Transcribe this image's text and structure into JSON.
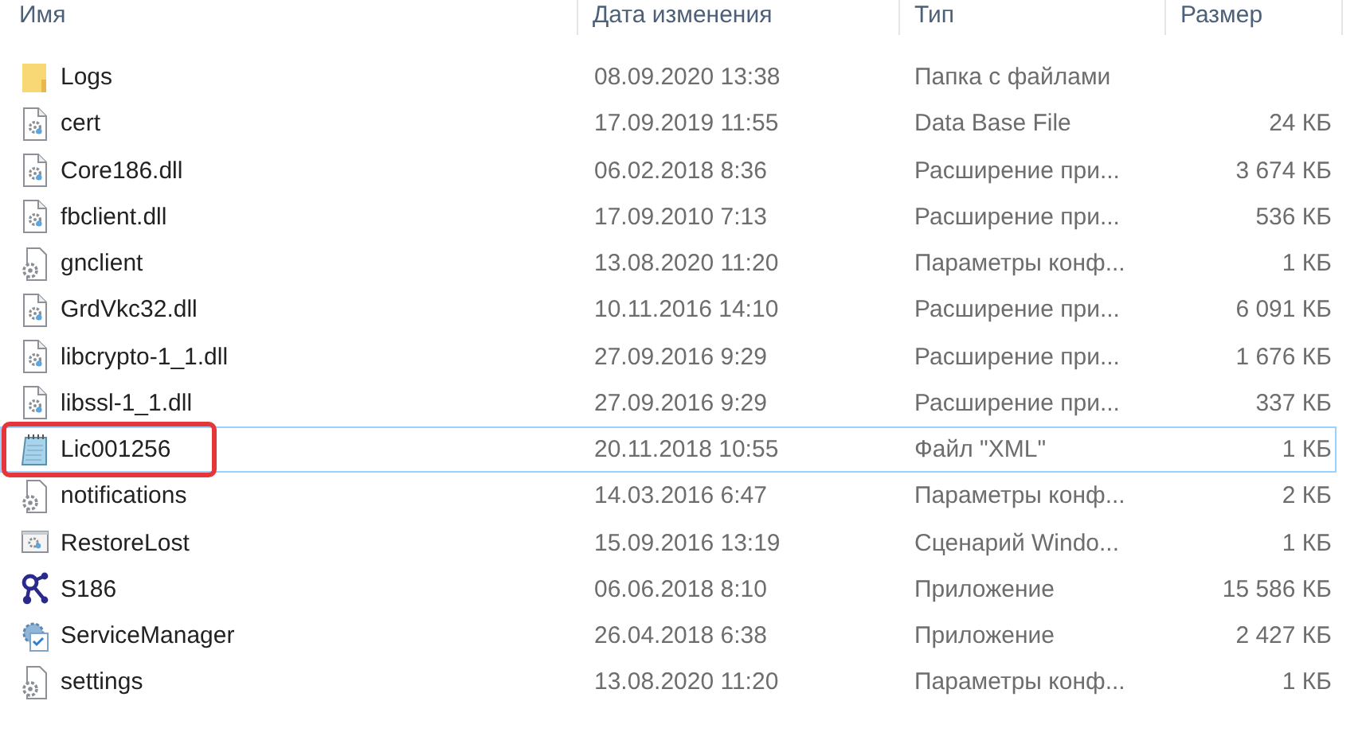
{
  "columns": [
    "Имя",
    "Дата изменения",
    "Тип",
    "Размер"
  ],
  "rows": [
    {
      "kind": "folder",
      "name": "Logs",
      "date": "08.09.2020 13:38",
      "type": "Папка с файлами",
      "size": "",
      "focused": false,
      "annotated": false
    },
    {
      "kind": "system",
      "name": "cert",
      "date": "17.09.2019 11:55",
      "type": "Data Base File",
      "size": "24 КБ",
      "focused": false,
      "annotated": false
    },
    {
      "kind": "system",
      "name": "Core186.dll",
      "date": "06.02.2018 8:36",
      "type": "Расширение при...",
      "size": "3 674 КБ",
      "focused": false,
      "annotated": false
    },
    {
      "kind": "system",
      "name": "fbclient.dll",
      "date": "17.09.2010 7:13",
      "type": "Расширение при...",
      "size": "536 КБ",
      "focused": false,
      "annotated": false
    },
    {
      "kind": "config",
      "name": "gnclient",
      "date": "13.08.2020 11:20",
      "type": "Параметры конф...",
      "size": "1 КБ",
      "focused": false,
      "annotated": false
    },
    {
      "kind": "system",
      "name": "GrdVkc32.dll",
      "date": "10.11.2016 14:10",
      "type": "Расширение при...",
      "size": "6 091 КБ",
      "focused": false,
      "annotated": false
    },
    {
      "kind": "system",
      "name": "libcrypto-1_1.dll",
      "date": "27.09.2016 9:29",
      "type": "Расширение при...",
      "size": "1 676 КБ",
      "focused": false,
      "annotated": false
    },
    {
      "kind": "system",
      "name": "libssl-1_1.dll",
      "date": "27.09.2016 9:29",
      "type": "Расширение при...",
      "size": "337 КБ",
      "focused": false,
      "annotated": false
    },
    {
      "kind": "notepad",
      "name": "Lic001256",
      "date": "20.11.2018 10:55",
      "type": "Файл \"XML\"",
      "size": "1 КБ",
      "focused": true,
      "annotated": true
    },
    {
      "kind": "config",
      "name": "notifications",
      "date": "14.03.2016 6:47",
      "type": "Параметры конф...",
      "size": "2 КБ",
      "focused": false,
      "annotated": false
    },
    {
      "kind": "script",
      "name": "RestoreLost",
      "date": "15.09.2016 13:19",
      "type": "Сценарий Windo...",
      "size": "1 КБ",
      "focused": false,
      "annotated": false
    },
    {
      "kind": "network",
      "name": "S186",
      "date": "06.06.2018 8:10",
      "type": "Приложение",
      "size": "15 586 КБ",
      "focused": false,
      "annotated": false
    },
    {
      "kind": "service",
      "name": "ServiceManager",
      "date": "26.04.2018 6:38",
      "type": "Приложение",
      "size": "2 427 КБ",
      "focused": false,
      "annotated": false
    },
    {
      "kind": "config",
      "name": "settings",
      "date": "13.08.2020 11:20",
      "type": "Параметры конф...",
      "size": "1 КБ",
      "focused": false,
      "annotated": false
    }
  ]
}
